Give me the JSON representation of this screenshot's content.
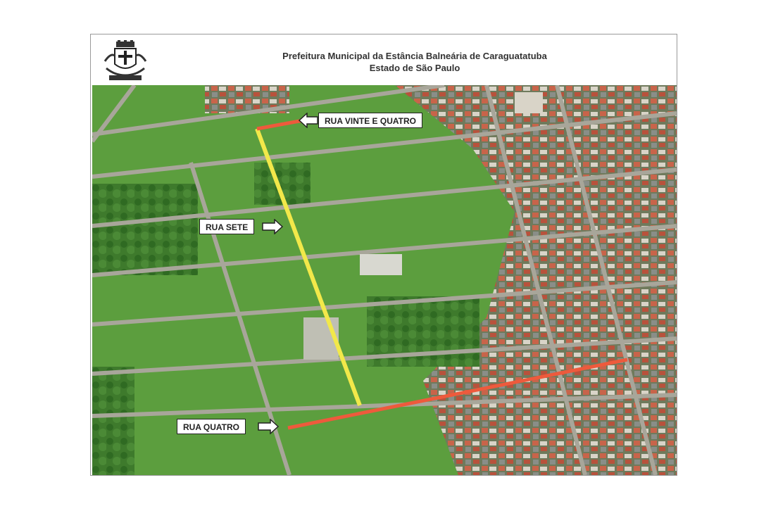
{
  "header": {
    "line1": "Prefeitura Municipal da Estância Balneária de Caraguatatuba",
    "line2": "Estado de São Paulo"
  },
  "crest_icon": "municipal-coat-of-arms-icon",
  "labels": {
    "top": "RUA VINTE E QUATRO",
    "middle": "RUA SETE",
    "bottom": "RUA QUATRO"
  },
  "colors": {
    "highlight_yellow": "#f2e84a",
    "highlight_red": "#ee5a3c",
    "grass": "#5c9e3e",
    "road": "#a8a69a"
  }
}
